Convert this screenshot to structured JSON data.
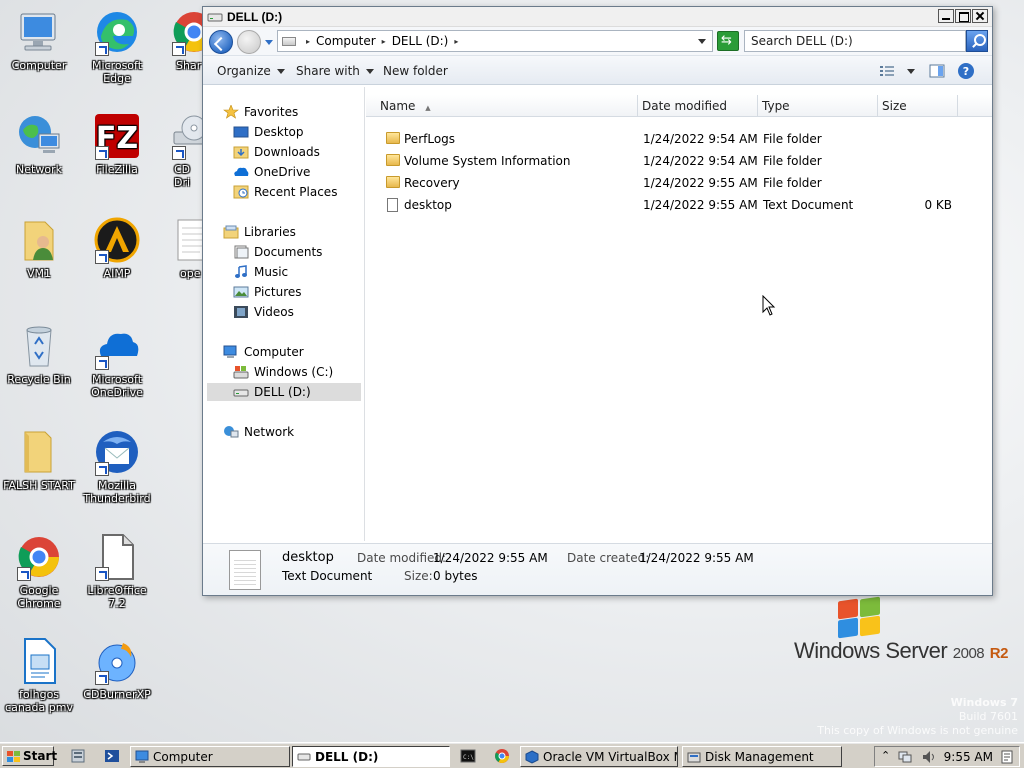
{
  "desktop": {
    "icons": [
      {
        "label": "Computer",
        "icon": "computer-icon"
      },
      {
        "label": "Microsoft Edge",
        "icon": "edge-icon"
      },
      {
        "label": "Shar",
        "icon": "chrome-share-icon"
      },
      {
        "label": "Network",
        "icon": "network-icon"
      },
      {
        "label": "FileZilla",
        "icon": "filezilla-icon"
      },
      {
        "label": "CD Dri",
        "icon": "cd-drive-icon"
      },
      {
        "label": "VM1",
        "icon": "user-folder-icon"
      },
      {
        "label": "AIMP",
        "icon": "aimp-icon"
      },
      {
        "label": "ope",
        "icon": "text-file-icon"
      },
      {
        "label": "Recycle Bin",
        "icon": "recycle-bin-icon"
      },
      {
        "label": "Microsoft OneDrive",
        "icon": "onedrive-icon"
      },
      {
        "label": "FALSH START",
        "icon": "folder-icon"
      },
      {
        "label": "Mozilla Thunderbird",
        "icon": "thunderbird-icon"
      },
      {
        "label": "Google Chrome",
        "icon": "chrome-icon"
      },
      {
        "label": "LibreOffice 7.2",
        "icon": "libreoffice-icon"
      },
      {
        "label": "folhgos canada pmv",
        "icon": "libreoffice-doc-icon"
      },
      {
        "label": "CDBurnerXP",
        "icon": "cdburnerxp-icon"
      }
    ],
    "logo": {
      "brand": "Windows Server",
      "version": "2008",
      "edition": "R2"
    },
    "watermark": {
      "line1": "Windows 7",
      "line2": "Build 7601",
      "line3": "This copy of Windows is not genuine"
    }
  },
  "window": {
    "title": "DELL (D:)",
    "address": {
      "segments": [
        "Computer",
        "DELL (D:)"
      ]
    },
    "search_placeholder": "Search DELL (D:)",
    "toolbar": {
      "organize": "Organize",
      "share_with": "Share with",
      "new_folder": "New folder"
    },
    "nav": {
      "favorites": "Favorites",
      "desktop": "Desktop",
      "downloads": "Downloads",
      "onedrive": "OneDrive",
      "recent": "Recent Places",
      "libraries": "Libraries",
      "documents": "Documents",
      "music": "Music",
      "pictures": "Pictures",
      "videos": "Videos",
      "computer": "Computer",
      "windows_c": "Windows (C:)",
      "dell_d": "DELL (D:)",
      "network": "Network"
    },
    "columns": {
      "name": "Name",
      "date": "Date modified",
      "type": "Type",
      "size": "Size"
    },
    "files": [
      {
        "name": "PerfLogs",
        "date": "1/24/2022 9:54 AM",
        "type": "File folder",
        "size": "",
        "kind": "folder"
      },
      {
        "name": "Volume System Information",
        "date": "1/24/2022 9:54 AM",
        "type": "File folder",
        "size": "",
        "kind": "folder"
      },
      {
        "name": "Recovery",
        "date": "1/24/2022 9:55 AM",
        "type": "File folder",
        "size": "",
        "kind": "folder"
      },
      {
        "name": "desktop",
        "date": "1/24/2022 9:55 AM",
        "type": "Text Document",
        "size": "0 KB",
        "kind": "document"
      }
    ],
    "details": {
      "name": "desktop",
      "type": "Text Document",
      "modified_label": "Date modified:",
      "modified": "1/24/2022 9:55 AM",
      "created_label": "Date created:",
      "created": "1/24/2022 9:55 AM",
      "size_label": "Size:",
      "size": "0 bytes"
    }
  },
  "taskbar": {
    "start": "Start",
    "buttons": [
      {
        "label": "Computer",
        "active": false
      },
      {
        "label": "DELL (D:)",
        "active": true
      },
      {
        "label": "Oracle VM VirtualBox Ma...",
        "active": false
      },
      {
        "label": "Disk Management",
        "active": false
      }
    ],
    "clock": "9:55 AM"
  },
  "colors": {
    "accent": "#2f6fc6",
    "selection": "#dcdcdc",
    "folder": "#e7b84d"
  }
}
